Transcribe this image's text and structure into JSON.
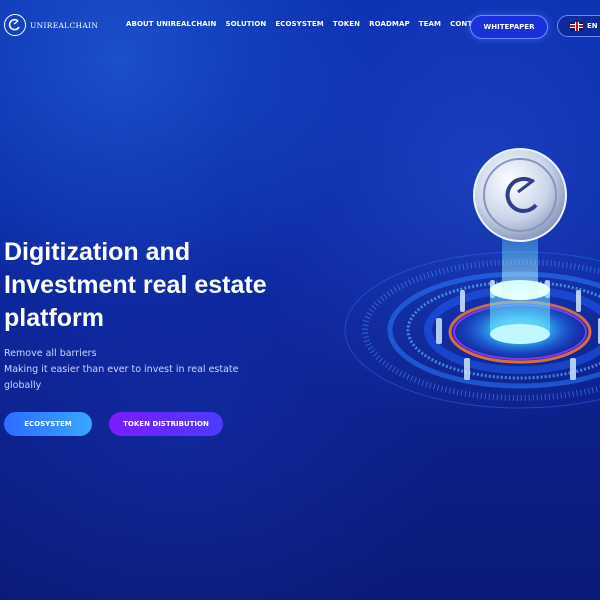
{
  "brand": {
    "name": "UNIREALCHAIN"
  },
  "nav": {
    "items": [
      "ABOUT UNIREALCHAIN",
      "SOLUTION",
      "ECOSYSTEM",
      "TOKEN",
      "ROADMAP",
      "TEAM",
      "CONTACT"
    ]
  },
  "header": {
    "whitepaper_label": "WHITEPAPER",
    "language_label": "EN"
  },
  "hero": {
    "title_lines": [
      "Digitization and",
      "Investment real estate",
      "platform"
    ],
    "subtitle_lines": [
      "Remove all barriers",
      "Making it easier than ever to invest in real estate",
      "globally"
    ],
    "ecosystem_button": "ECOSYSTEM",
    "token_button": "TOKEN DISTRIBUTION"
  },
  "colors": {
    "background": "#0a2aa6",
    "accent_blue": "#2e6bff",
    "accent_purple": "#7a1cff",
    "glow": "#4fe3ff"
  },
  "icons": [
    "logo-icon",
    "uk-flag-icon",
    "coin-icon"
  ]
}
